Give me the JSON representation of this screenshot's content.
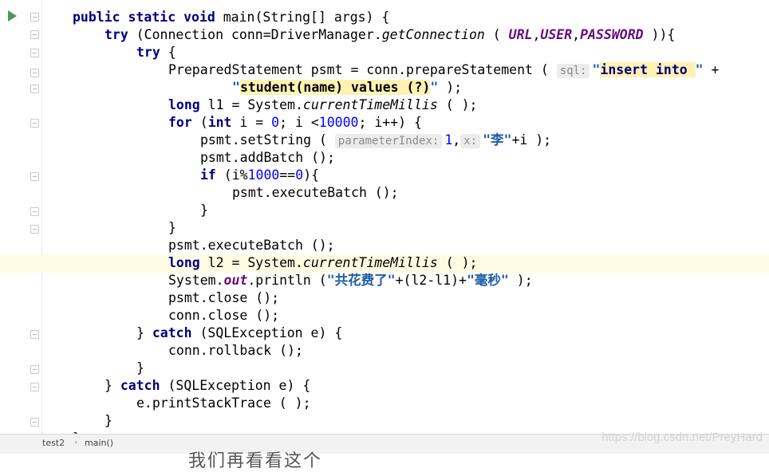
{
  "code": {
    "l0": {
      "kw": "public static void",
      "rest": " main(String[] args) {"
    },
    "l1": {
      "try": "try",
      "a": " (Connection conn=DriverManager.",
      "method": "getConnection",
      "b": " ( ",
      "url": "URL",
      "c1": ",",
      "user": "USER",
      "c2": ",",
      "pwd": "PASSWORD",
      "d": " )){"
    },
    "l2": {
      "try": "try",
      "rest": " {"
    },
    "l3": {
      "a": "PreparedStatement psmt = conn.prepareStatement ( ",
      "hint": "sql:",
      "s1": "\"",
      "sql1": "insert into ",
      "s2": "\"",
      "plus": " +"
    },
    "l4": {
      "s1": "\"",
      "sql2": "student(name) values (?)",
      "s2": "\"",
      "end": " );"
    },
    "l5": {
      "kw": "long",
      "a": " l1 = System.",
      "method": "currentTimeMillis",
      "b": " ( );"
    },
    "l6": {
      "kw1": "for",
      "a": " (",
      "kw2": "int",
      "b": " i = ",
      "n0": "0",
      "c": "; i <",
      "n1": "10000",
      "d": "; i++) {"
    },
    "l7": {
      "a": "psmt.setString ( ",
      "hint1": "parameterIndex:",
      "n1": "1",
      "comma": ",",
      "hint2": "x:",
      "str": "\"李\"",
      "b": "+i );"
    },
    "l8": {
      "a": "psmt.addBatch ();"
    },
    "l9": {
      "kw": "if",
      "a": " (i%",
      "n": "1000",
      "b": "==",
      "n0": "0",
      "c": "){"
    },
    "l10": {
      "a": "psmt.executeBatch ();"
    },
    "l11": {
      "a": "}"
    },
    "l12": {
      "a": "}"
    },
    "l13": {
      "a": "psmt.executeBatch ();"
    },
    "l14": {
      "kw": "long",
      "a": " l2 = System.",
      "method": "currentTimeMillis",
      "b": " ( );"
    },
    "l15": {
      "a": "System.",
      "field": "out",
      "b": ".println (",
      "s1": "\"共花费了\"",
      "c": "+(l2-l1)+",
      "s2": "\"毫秒\"",
      "d": " );"
    },
    "l16": {
      "a": "psmt.close ();"
    },
    "l17": {
      "a": "conn.close ();"
    },
    "l18": {
      "a": "} ",
      "kw": "catch",
      "b": " (SQLException e) {"
    },
    "l19": {
      "a": "conn.rollback ();"
    },
    "l20": {
      "a": "}"
    },
    "l21": {
      "a": "} ",
      "kw": "catch",
      "b": " (SQLException e) {"
    },
    "l22": {
      "a": "e.printStackTrace ( );"
    },
    "l23": {
      "a": "}"
    },
    "l24": {
      "a": "}"
    }
  },
  "breadcrumb": {
    "class": "test2",
    "sep": "›",
    "method": "main()"
  },
  "watermark": "https://blog.csdn.net/PreyHard",
  "bottom_text": "我们再看看这个",
  "colors": {
    "keyword": "#000080",
    "string": "#1f5ea8",
    "number": "#0000ff",
    "static_field": "#660e7a",
    "current_line": "#fffae3",
    "run_icon": "#499c54"
  },
  "icons": {
    "run": "run-arrow-icon",
    "fold": "fold-marker-icon"
  }
}
